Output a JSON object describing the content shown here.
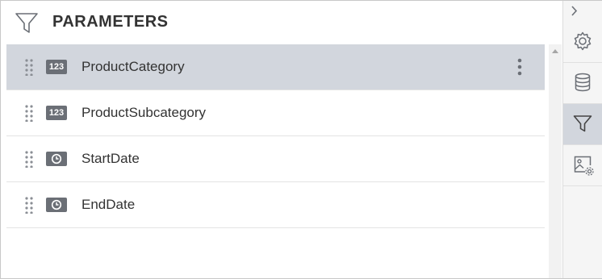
{
  "header": {
    "title": "PARAMETERS",
    "icon": "filter-icon"
  },
  "parameters": [
    {
      "name": "ProductCategory",
      "type_label": "123",
      "type_icon": "number-type-icon",
      "selected": true
    },
    {
      "name": "ProductSubcategory",
      "type_label": "123",
      "type_icon": "number-type-icon",
      "selected": false
    },
    {
      "name": "StartDate",
      "type_label": "",
      "type_icon": "datetime-type-icon",
      "selected": false
    },
    {
      "name": "EndDate",
      "type_label": "",
      "type_icon": "datetime-type-icon",
      "selected": false
    }
  ],
  "rail": {
    "collapse_icon": "chevron-right-icon",
    "tabs": [
      {
        "icon": "gear-icon",
        "active": false
      },
      {
        "icon": "database-icon",
        "active": false
      },
      {
        "icon": "filter-icon",
        "active": true
      },
      {
        "icon": "image-settings-icon",
        "active": false
      }
    ]
  },
  "colors": {
    "selected_bg": "#d2d6dd",
    "badge_bg": "#6b6f76",
    "text": "#333333"
  }
}
